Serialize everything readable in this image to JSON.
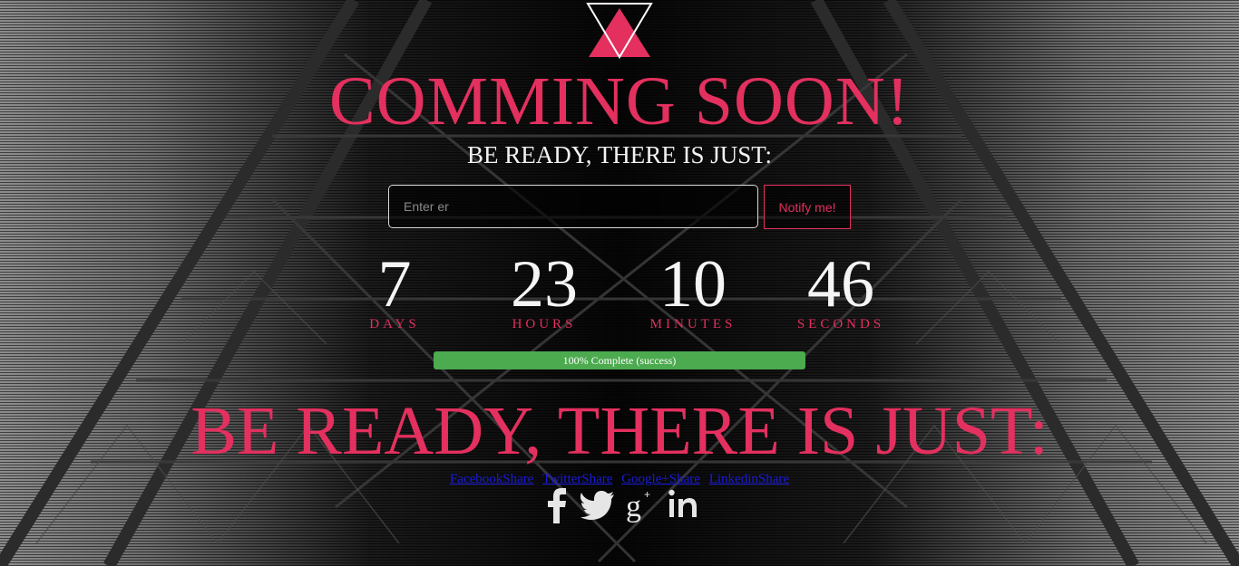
{
  "logo": {
    "icon": "triangle-logo-icon",
    "accent": "#e3305f"
  },
  "header": {
    "title": "COMMING SOON!",
    "subtitle": "BE READY, THERE IS JUST:"
  },
  "subscribe": {
    "placeholder": "Enter er",
    "button_label": "Notify me!"
  },
  "countdown": {
    "days": {
      "value": "7",
      "label": "DAYS"
    },
    "hours": {
      "value": "23",
      "label": "HOURS"
    },
    "minutes": {
      "value": "10",
      "label": "MINUTES"
    },
    "seconds": {
      "value": "46",
      "label": "SECONDS"
    }
  },
  "progress": {
    "percent": 100,
    "label": "100% Complete (success)",
    "color": "#4caa4f"
  },
  "footer": {
    "headline": "BE READY, THERE IS JUST:",
    "share_links": [
      "FacebookShare",
      "TwitterShare",
      "Google+Share",
      "LinkedinShare"
    ],
    "social_icons": [
      "facebook-icon",
      "twitter-icon",
      "google-plus-icon",
      "linkedin-icon"
    ]
  }
}
